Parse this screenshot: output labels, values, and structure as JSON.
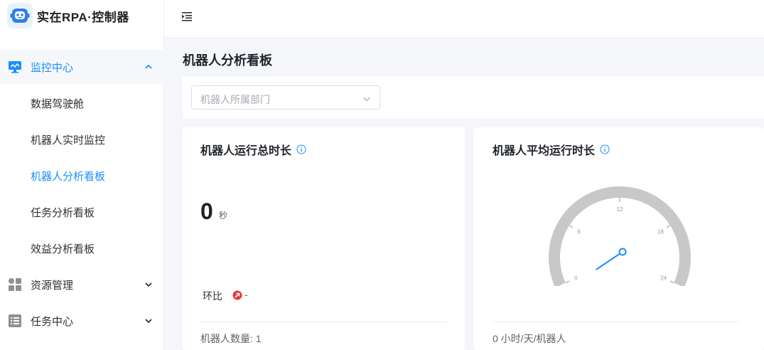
{
  "app": {
    "title": "实在RPA·控制器"
  },
  "sidebar": {
    "groups": [
      {
        "label": "监控中心",
        "icon": "monitor-icon",
        "expanded": true
      },
      {
        "label": "资源管理",
        "icon": "grid-icon",
        "expanded": false
      },
      {
        "label": "任务中心",
        "icon": "list-icon",
        "expanded": false
      }
    ],
    "sub_items": [
      {
        "label": "数据驾驶舱"
      },
      {
        "label": "机器人实时监控"
      },
      {
        "label": "机器人分析看板",
        "active": true
      },
      {
        "label": "任务分析看板"
      },
      {
        "label": "效益分析看板"
      }
    ]
  },
  "page": {
    "title": "机器人分析看板",
    "filter": {
      "placeholder": "机器人所属部门"
    }
  },
  "card_total": {
    "title": "机器人运行总时长",
    "value": "0",
    "unit": "秒",
    "ratio_label": "环比",
    "ratio_value": "-",
    "footer": "机器人数量: 1"
  },
  "card_avg": {
    "title": "机器人平均运行时长",
    "footer": "0 小时/天/机器人",
    "gauge": {
      "value": 0,
      "min": 0,
      "max": 24,
      "ticks": [
        "0",
        "6",
        "12",
        "18",
        "24"
      ]
    }
  },
  "colors": {
    "accent": "#1890ff",
    "gauge_track": "#c8c8c8",
    "negative": "#e4393c"
  }
}
